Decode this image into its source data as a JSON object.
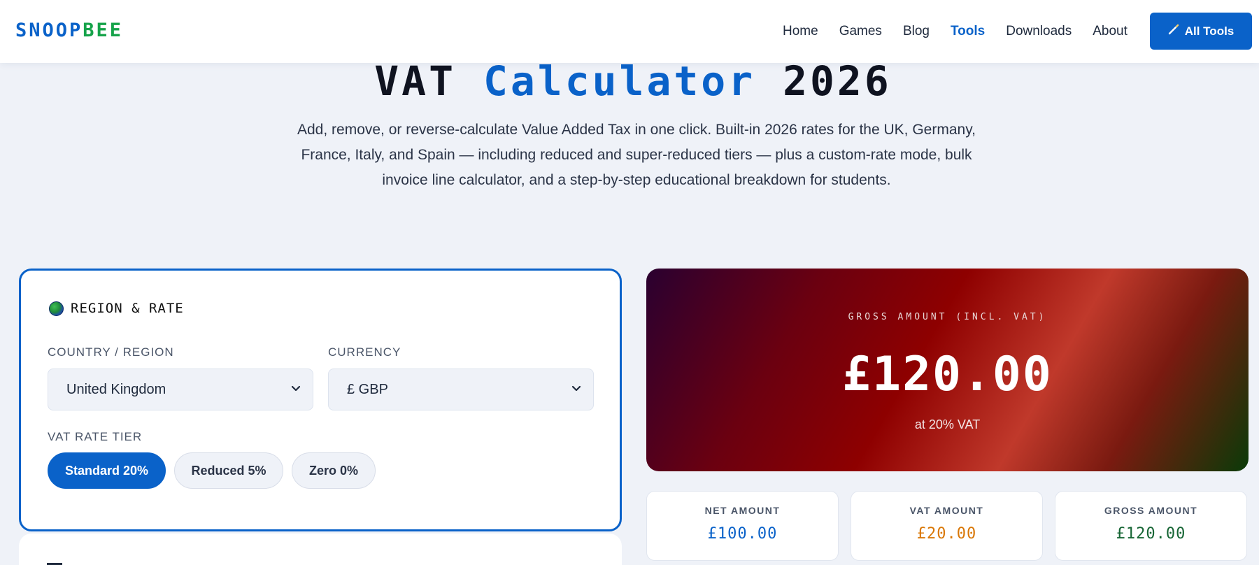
{
  "header": {
    "logo_part1": "SNOOP",
    "logo_part2": "BEE",
    "nav": [
      "Home",
      "Games",
      "Blog",
      "Tools",
      "Downloads",
      "About"
    ],
    "active_nav": "Tools",
    "cta_label": "All Tools",
    "cta_icon": "wand-icon"
  },
  "hero": {
    "title_part1": "VAT",
    "title_part2": "Calculator",
    "title_part3": "2026",
    "subtitle": "Add, remove, or reverse-calculate Value Added Tax in one click. Built-in 2026 rates for the UK, Germany, France, Italy, and Spain — including reduced and super-reduced tiers — plus a custom-rate mode, bulk invoice line calculator, and a step-by-step educational breakdown for students."
  },
  "region_card": {
    "title": "REGION & RATE",
    "icon": "globe-icon",
    "country_label": "COUNTRY / REGION",
    "country_value": "United Kingdom",
    "currency_label": "CURRENCY",
    "currency_value": "£ GBP",
    "tier_label": "VAT RATE TIER",
    "tiers": [
      "Standard 20%",
      "Reduced 5%",
      "Zero 0%"
    ],
    "active_tier": "Standard 20%"
  },
  "result": {
    "label": "GROSS AMOUNT (INCL. VAT)",
    "value": "£120.00",
    "sub": "at 20% VAT"
  },
  "stats": [
    {
      "label": "NET AMOUNT",
      "value": "£100.00",
      "color": "#0a62c9"
    },
    {
      "label": "VAT AMOUNT",
      "value": "£20.00",
      "color": "#d97706"
    },
    {
      "label": "GROSS AMOUNT",
      "value": "£120.00",
      "color": "#166534"
    }
  ],
  "colors": {
    "primary": "#0a62c9",
    "brand_green": "#16a34a",
    "background": "#eff2f8"
  }
}
